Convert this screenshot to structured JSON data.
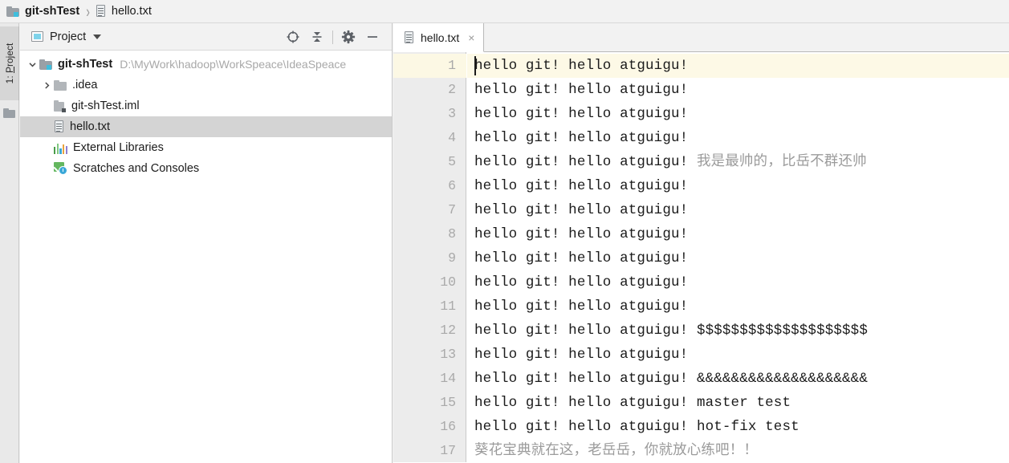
{
  "breadcrumb": {
    "items": [
      {
        "label": "git-shTest",
        "icon": "folder-icon",
        "bold": true
      },
      {
        "label": "hello.txt",
        "icon": "text-file-icon",
        "bold": false
      }
    ],
    "separator": "›"
  },
  "toolstrip": {
    "project_tab": {
      "number": "1",
      "label": "Project",
      "prefix": "1: "
    },
    "folder_icon": "folder-icon"
  },
  "project_panel": {
    "title": "Project",
    "dropdown_icon": "chevron-down-icon",
    "actions": [
      {
        "name": "select-opened-file-icon",
        "title": "Select Opened File"
      },
      {
        "name": "collapse-all-icon",
        "title": "Collapse All"
      },
      {
        "name": "settings-gear-icon",
        "title": "Settings"
      },
      {
        "name": "hide-icon",
        "title": "Hide"
      }
    ],
    "tree": [
      {
        "label": "git-shTest",
        "path": "D:\\MyWork\\hadoop\\WorkSpeace\\IdeaSpeace",
        "icon": "project-folder-icon",
        "twisty": "expanded",
        "indent": 0,
        "bold": true,
        "selected": false
      },
      {
        "label": ".idea",
        "path": "",
        "icon": "folder-icon",
        "twisty": "collapsed",
        "indent": 1,
        "bold": false,
        "selected": false
      },
      {
        "label": "git-shTest.iml",
        "path": "",
        "icon": "module-file-icon",
        "twisty": "none",
        "indent": 1,
        "bold": false,
        "selected": false
      },
      {
        "label": "hello.txt",
        "path": "",
        "icon": "text-file-icon",
        "twisty": "none",
        "indent": 1,
        "bold": false,
        "selected": true
      },
      {
        "label": "External Libraries",
        "path": "",
        "icon": "libraries-bars-icon",
        "twisty": "none",
        "indent": 0,
        "bold": false,
        "selected": false
      },
      {
        "label": "Scratches and Consoles",
        "path": "",
        "icon": "scratches-icon",
        "twisty": "none",
        "indent": 0,
        "bold": false,
        "selected": false
      }
    ]
  },
  "editor": {
    "tab": {
      "label": "hello.txt",
      "icon": "text-file-icon",
      "close_glyph": "×"
    },
    "caret_line": 1,
    "lines": [
      {
        "n": "1",
        "ascii": "hello git! hello atguigu!",
        "extra": ""
      },
      {
        "n": "2",
        "ascii": "hello git! hello atguigu!",
        "extra": ""
      },
      {
        "n": "3",
        "ascii": "hello git! hello atguigu!",
        "extra": ""
      },
      {
        "n": "4",
        "ascii": "hello git! hello atguigu!",
        "extra": ""
      },
      {
        "n": "5",
        "ascii": "hello git! hello atguigu! ",
        "extra": "我是最帅的，比岳不群还帅"
      },
      {
        "n": "6",
        "ascii": "hello git! hello atguigu!",
        "extra": ""
      },
      {
        "n": "7",
        "ascii": "hello git! hello atguigu!",
        "extra": ""
      },
      {
        "n": "8",
        "ascii": "hello git! hello atguigu!",
        "extra": ""
      },
      {
        "n": "9",
        "ascii": "hello git! hello atguigu!",
        "extra": ""
      },
      {
        "n": "10",
        "ascii": "hello git! hello atguigu!",
        "extra": ""
      },
      {
        "n": "11",
        "ascii": "hello git! hello atguigu!",
        "extra": ""
      },
      {
        "n": "12",
        "ascii": "hello git! hello atguigu! $$$$$$$$$$$$$$$$$$$$",
        "extra": ""
      },
      {
        "n": "13",
        "ascii": "hello git! hello atguigu!",
        "extra": ""
      },
      {
        "n": "14",
        "ascii": "hello git! hello atguigu! &&&&&&&&&&&&&&&&&&&&",
        "extra": ""
      },
      {
        "n": "15",
        "ascii": "hello git! hello atguigu! master test",
        "extra": ""
      },
      {
        "n": "16",
        "ascii": "hello git! hello atguigu! hot-fix test",
        "extra": ""
      },
      {
        "n": "17",
        "ascii": "",
        "extra": "葵花宝典就在这，老岳岳，你就放心练吧！！"
      }
    ]
  },
  "colors": {
    "chrome": "#f2f2f2",
    "panel_bg": "#ffffff",
    "gutter_bg": "#ececec",
    "selection": "#d4d4d4",
    "caret_row": "#fdf9e6",
    "accent_blue": "#3fbedd",
    "muted_text": "#a8a8a8",
    "cjk_text": "#9b9b9b"
  }
}
